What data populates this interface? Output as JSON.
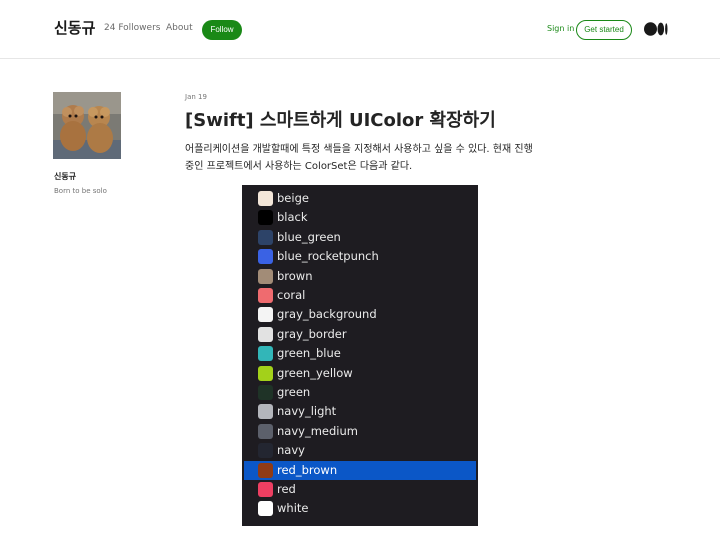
{
  "header": {
    "author_name": "신동규",
    "followers": "24 Followers",
    "about": "About",
    "follow": "Follow",
    "sign_in": "Sign in",
    "get_started": "Get started"
  },
  "sidebar": {
    "name": "신동규",
    "bio": "Born to be solo"
  },
  "post": {
    "date": "Jan 19",
    "title": "[Swift] 스마트하게 UIColor 확장하기",
    "text": "어플리케이션을 개발할때에 특정 색들을 지정해서 사용하고 싶을 수 있다. 현재 진행중인 프로젝트에서 사용하는 ColorSet은 다음과 같다."
  },
  "colorset": {
    "items": [
      {
        "name": "beige",
        "color": "#f3e6d9"
      },
      {
        "name": "black",
        "color": "#000000"
      },
      {
        "name": "blue_green",
        "color": "#2d4368"
      },
      {
        "name": "blue_rocketpunch",
        "color": "#3a62e4"
      },
      {
        "name": "brown",
        "color": "#a28c77"
      },
      {
        "name": "coral",
        "color": "#ef6b6f"
      },
      {
        "name": "gray_background",
        "color": "#f4f4f4"
      },
      {
        "name": "gray_border",
        "color": "#e2e2e2"
      },
      {
        "name": "green_blue",
        "color": "#32b6b8"
      },
      {
        "name": "green_yellow",
        "color": "#a3d11a"
      },
      {
        "name": "green",
        "color": "#1f3327"
      },
      {
        "name": "navy_light",
        "color": "#b4b6bc"
      },
      {
        "name": "navy_medium",
        "color": "#5c606b"
      },
      {
        "name": "navy",
        "color": "#232631"
      },
      {
        "name": "red_brown",
        "color": "#8f3b16"
      },
      {
        "name": "red",
        "color": "#ee3f62"
      },
      {
        "name": "white",
        "color": "#ffffff"
      }
    ],
    "selected_index": 14
  }
}
